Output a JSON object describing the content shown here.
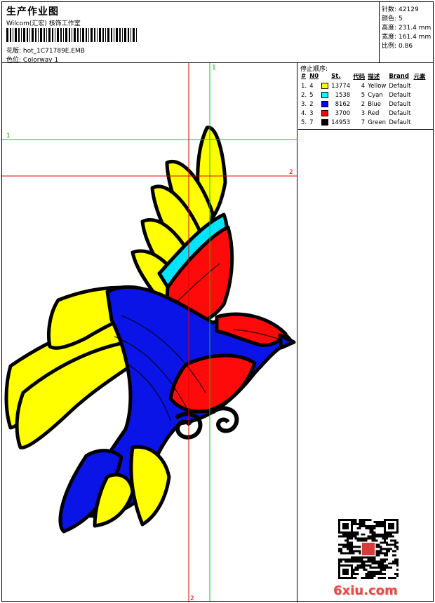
{
  "header": {
    "title": "生产作业图",
    "subtitle": "Wilcom(汇宏) 核饰工作室",
    "file_label": "花版:",
    "file_name": "hot_1C71789E.EMB",
    "colorway_label": "色位:",
    "colorway_name": "Colorway 1"
  },
  "stats": [
    {
      "label": "针数:",
      "value": "42129"
    },
    {
      "label": "颜色:",
      "value": "5"
    },
    {
      "label": "高度:",
      "value": "231.4 mm"
    },
    {
      "label": "宽度:",
      "value": "161.4 mm"
    },
    {
      "label": "比例:",
      "value": "0.86"
    }
  ],
  "sequence": {
    "title": "停止顺序:",
    "headers": [
      "#",
      "N0",
      "St.",
      "代码",
      "描述",
      "Brand",
      "元素"
    ],
    "rows": [
      {
        "idx": "1.",
        "needle": "4",
        "stitches": "13774",
        "code": "4",
        "desc": "Yellow",
        "brand": "Default",
        "color": "#ffff00"
      },
      {
        "idx": "2.",
        "needle": "5",
        "stitches": "1538",
        "code": "5",
        "desc": "Cyan",
        "brand": "Default",
        "color": "#00ffff"
      },
      {
        "idx": "3.",
        "needle": "2",
        "stitches": "8162",
        "code": "2",
        "desc": "Blue",
        "brand": "Default",
        "color": "#0000ff"
      },
      {
        "idx": "4.",
        "needle": "3",
        "stitches": "3700",
        "code": "3",
        "desc": "Red",
        "brand": "Default",
        "color": "#ff0000"
      },
      {
        "idx": "5.",
        "needle": "7",
        "stitches": "14953",
        "code": "7",
        "desc": "Green",
        "brand": "Default",
        "color": "#000000"
      }
    ]
  },
  "guides": {
    "green_v": "1",
    "green_h": "1",
    "red_h": "2",
    "red_v": "2"
  },
  "watermark": "6xiu.com",
  "colors": {
    "yellow": "#ffff00",
    "cyan": "#00e5ff",
    "blue": "#0a14e6",
    "red": "#ff0a0a",
    "black": "#000000",
    "guide_green": "#00cc00",
    "guide_red": "#e00000"
  }
}
